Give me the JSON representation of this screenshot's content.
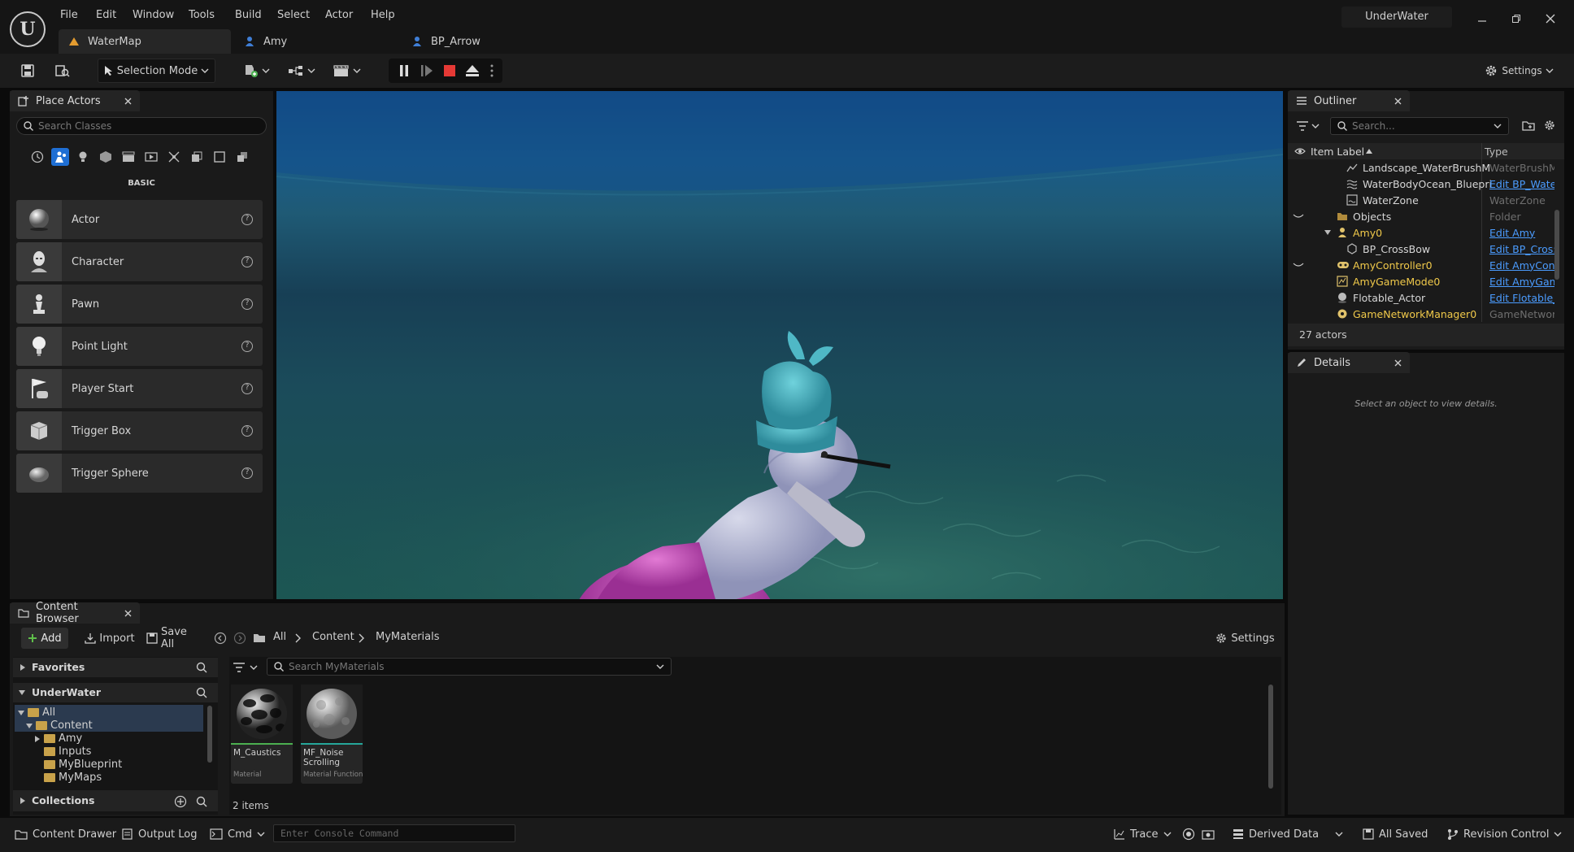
{
  "menu": [
    "File",
    "Edit",
    "Window",
    "Tools",
    "Build",
    "Select",
    "Actor",
    "Help"
  ],
  "tabs": [
    {
      "label": "WaterMap"
    },
    {
      "label": "Amy"
    },
    {
      "label": "BP_Arrow"
    }
  ],
  "project_name": "UnderWater",
  "toolbar": {
    "selection_mode": "Selection Mode",
    "settings": "Settings"
  },
  "place_actors": {
    "title": "Place Actors",
    "search_placeholder": "Search Classes",
    "category": "BASIC",
    "items": [
      {
        "label": "Actor",
        "icon": "sphere-icon"
      },
      {
        "label": "Character",
        "icon": "character-icon"
      },
      {
        "label": "Pawn",
        "icon": "pawn-icon"
      },
      {
        "label": "Point Light",
        "icon": "light-bulb-icon"
      },
      {
        "label": "Player Start",
        "icon": "player-start-flag-icon"
      },
      {
        "label": "Trigger Box",
        "icon": "trigger-box-icon"
      },
      {
        "label": "Trigger Sphere",
        "icon": "trigger-sphere-icon"
      }
    ]
  },
  "outliner": {
    "title": "Outliner",
    "search_placeholder": "Search...",
    "col_label": "Item Label",
    "col_type": "Type",
    "rows": [
      {
        "name": "Landscape_WaterBrushM",
        "type": "WaterBrushM",
        "link": false
      },
      {
        "name": "WaterBodyOcean_Bluepri",
        "type": "Edit BP_Wate",
        "link": true
      },
      {
        "name": "WaterZone",
        "type": "WaterZone",
        "link": false
      },
      {
        "name": "Objects",
        "type": "Folder",
        "link": false
      },
      {
        "name": "Amy0",
        "type": "Edit Amy",
        "link": true
      },
      {
        "name": "BP_CrossBow",
        "type": "Edit BP_Cros:",
        "link": true
      },
      {
        "name": "AmyController0",
        "type": "Edit AmyCont",
        "link": true
      },
      {
        "name": "AmyGameMode0",
        "type": "Edit AmyGam",
        "link": true
      },
      {
        "name": "Flotable_Actor",
        "type": "Edit Flotable_",
        "link": true
      },
      {
        "name": "GameNetworkManager0",
        "type": "GameNetwor",
        "link": false
      }
    ],
    "count": "27 actors"
  },
  "details": {
    "title": "Details",
    "empty": "Select an object to view details."
  },
  "content_browser": {
    "title": "Content Browser",
    "add": "Add",
    "import": "Import",
    "save_all": "Save All",
    "breadcrumb": [
      "All",
      "Content",
      "MyMaterials"
    ],
    "settings": "Settings",
    "favorites": "Favorites",
    "project": "UnderWater",
    "tree": [
      "All",
      "Content",
      "Amy",
      "Inputs",
      "MyBlueprint",
      "MyMaps"
    ],
    "collections": "Collections",
    "search_placeholder": "Search MyMaterials",
    "assets": [
      {
        "name": "M_Caustics",
        "type": "Material",
        "accent": "#4caf50"
      },
      {
        "name": "MF_Noise Scrolling",
        "type": "Material Function",
        "accent": "#26a69a"
      }
    ],
    "item_count": "2 items"
  },
  "statusbar": {
    "content_drawer": "Content Drawer",
    "output_log": "Output Log",
    "cmd": "Cmd",
    "console_placeholder": "Enter Console Command",
    "trace": "Trace",
    "derived_data": "Derived Data",
    "all_saved": "All Saved",
    "revision_control": "Revision Control"
  }
}
